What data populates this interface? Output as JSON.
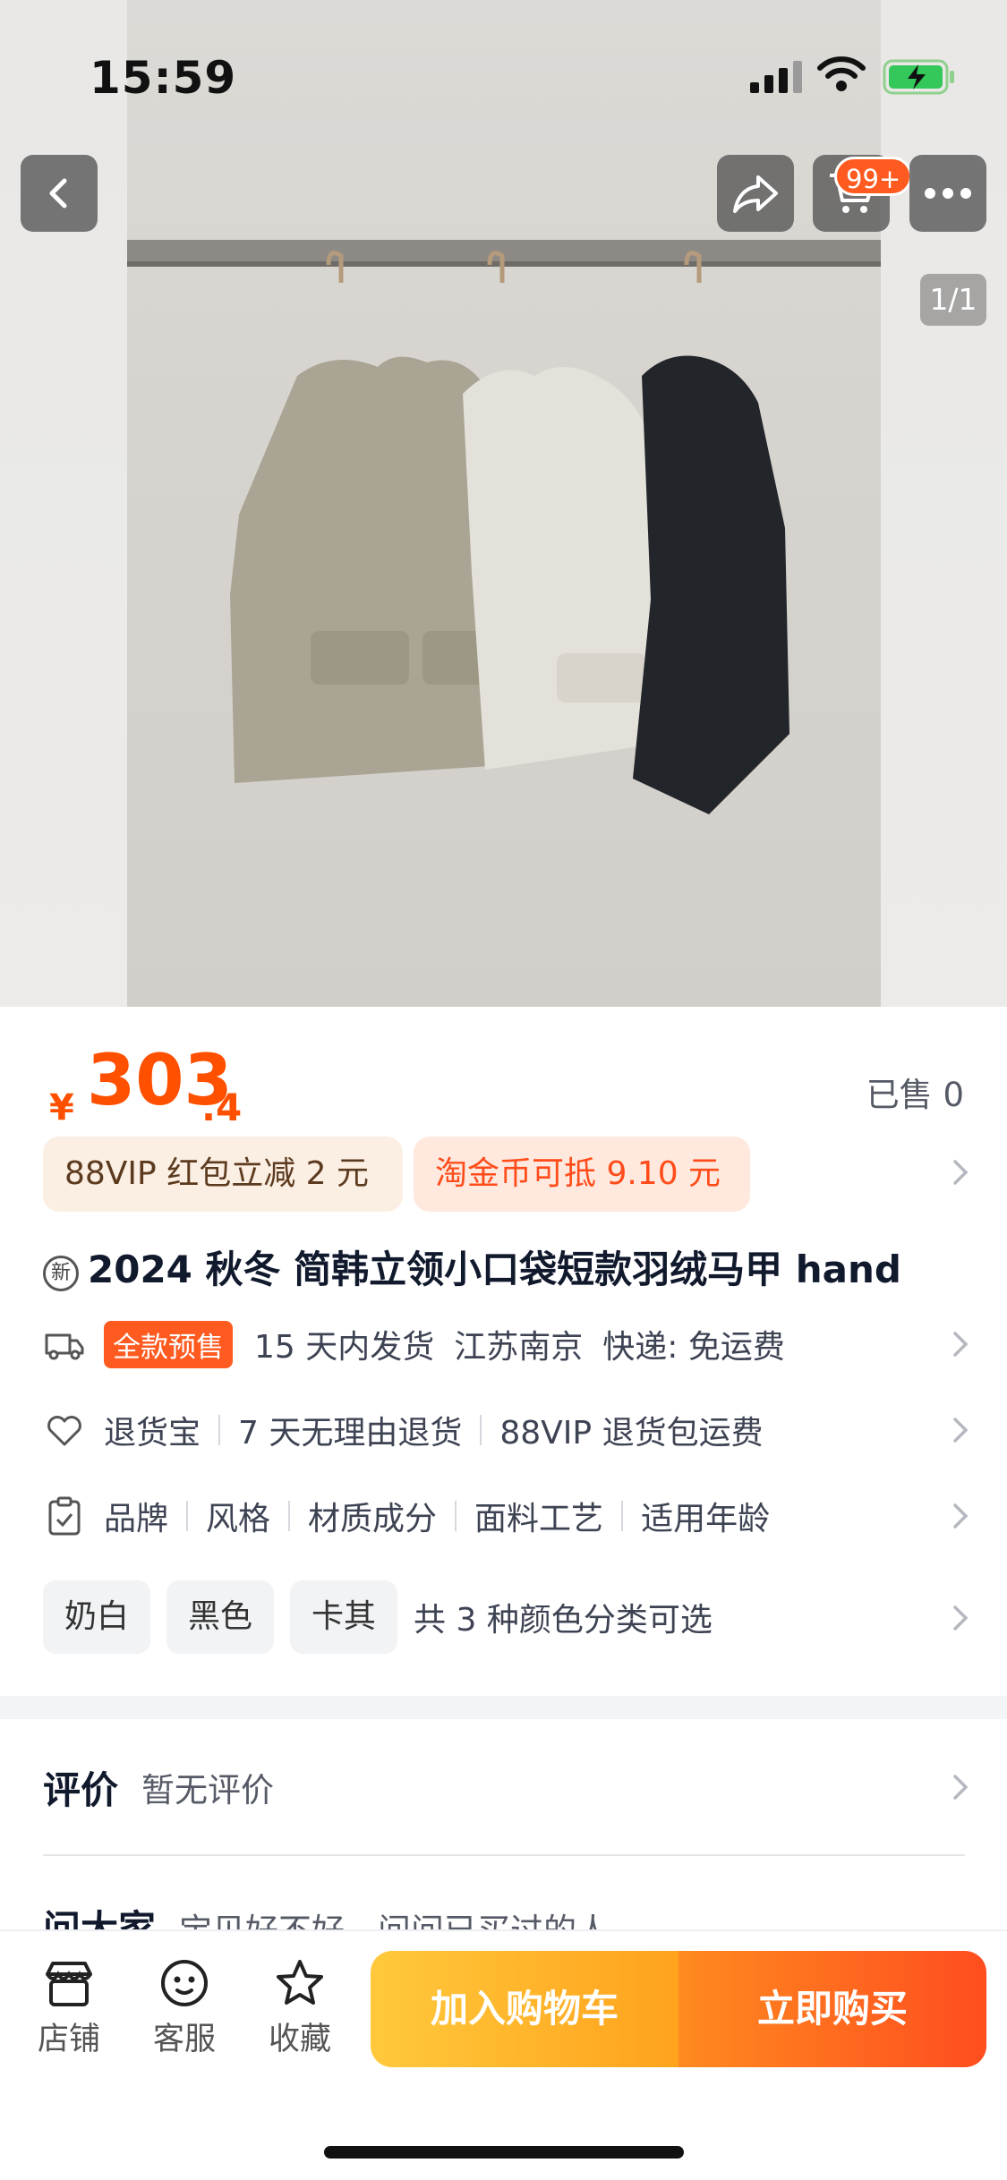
{
  "status": {
    "time": "15:59"
  },
  "nav": {
    "cart_badge": "99+",
    "pager": "1/1"
  },
  "price": {
    "currency": "¥",
    "integer": "303",
    "decimal": ".4",
    "sold": "已售 0"
  },
  "coupons": [
    "88VIP 红包立减 2 元",
    "淘金币可抵 9.10 元"
  ],
  "product": {
    "title": "2024 秋冬 简韩立领小口袋短款羽绒马甲 hand",
    "new_icon_label": "新"
  },
  "shipping": {
    "presale": "全款预售",
    "delivery": "15 天内发货",
    "location": "江苏南京",
    "express": "快递: 免运费"
  },
  "returns": [
    "退货宝",
    "7 天无理由退货",
    "88VIP 退货包运费"
  ],
  "params": [
    "品牌",
    "风格",
    "材质成分",
    "面料工艺",
    "适用年龄"
  ],
  "colors": {
    "options": [
      "奶白",
      "黑色",
      "卡其"
    ],
    "summary": "共 3 种颜色分类可选"
  },
  "review": {
    "label": "评价",
    "value": "暂无评价"
  },
  "ask": {
    "label": "问大家",
    "value": "宝贝好不好，问问已买过的人"
  },
  "bottom": {
    "store": "店铺",
    "service": "客服",
    "favorite": "收藏",
    "add_cart": "加入购物车",
    "buy_now": "立即购买"
  },
  "icons": [
    "back-icon",
    "share-icon",
    "cart-icon",
    "more-icon",
    "truck-icon",
    "shield-heart-icon",
    "clipboard-icon",
    "store-icon",
    "service-icon",
    "star-icon",
    "chevron-right-icon"
  ],
  "colors_ui": {
    "accent": "#ff5000",
    "coupon_text": "#5c3a1e"
  }
}
